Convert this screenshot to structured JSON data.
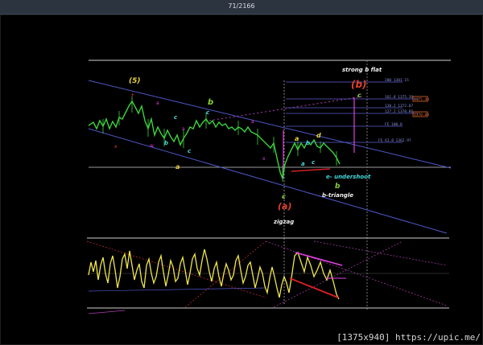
{
  "viewer": {
    "counter": "71/2166",
    "footer": "[1375x940] https://upic.me/"
  },
  "chart": {
    "annotations": {
      "wave5": "(5)",
      "wave_b_top": "b",
      "wave_a_big": "(a)",
      "wave_b_big": "(b)",
      "wave_c_small": "c",
      "wave_c_top": "c",
      "wave_d": "d",
      "wave_b_tri": "b",
      "strong_b_flat": "strong b flat",
      "zigzag": "zigzag",
      "e_undershoot": "e- undershoot",
      "b_triangle": "b-triangle",
      "a_left": "a",
      "a_mid": "a",
      "a_tri": "a",
      "b_tri": "b",
      "c_tri": "c",
      "b_left": "b",
      "c_left": "c",
      "c_mid": "c",
      "c_arrow": "c"
    },
    "fib_labels": [
      "200 1381.15",
      "161.8 1375.39",
      "138.2 1372.07",
      "127.2 1370.86",
      "FE 100.0",
      "FE 61.8 1362.97"
    ],
    "price_tags": [
      "1375.40",
      "1370.80"
    ],
    "colors": {
      "price": "#3cd23c",
      "oscillator": "#f0e64a",
      "channel": "#4f58c9",
      "wave_yellow": "#e6d23a",
      "wave_red": "#e0402c",
      "wave_cyan": "#44d8d8",
      "wave_magenta": "#e040e0",
      "fib": "#5a5fcf",
      "tag": "#e06a2a"
    }
  }
}
